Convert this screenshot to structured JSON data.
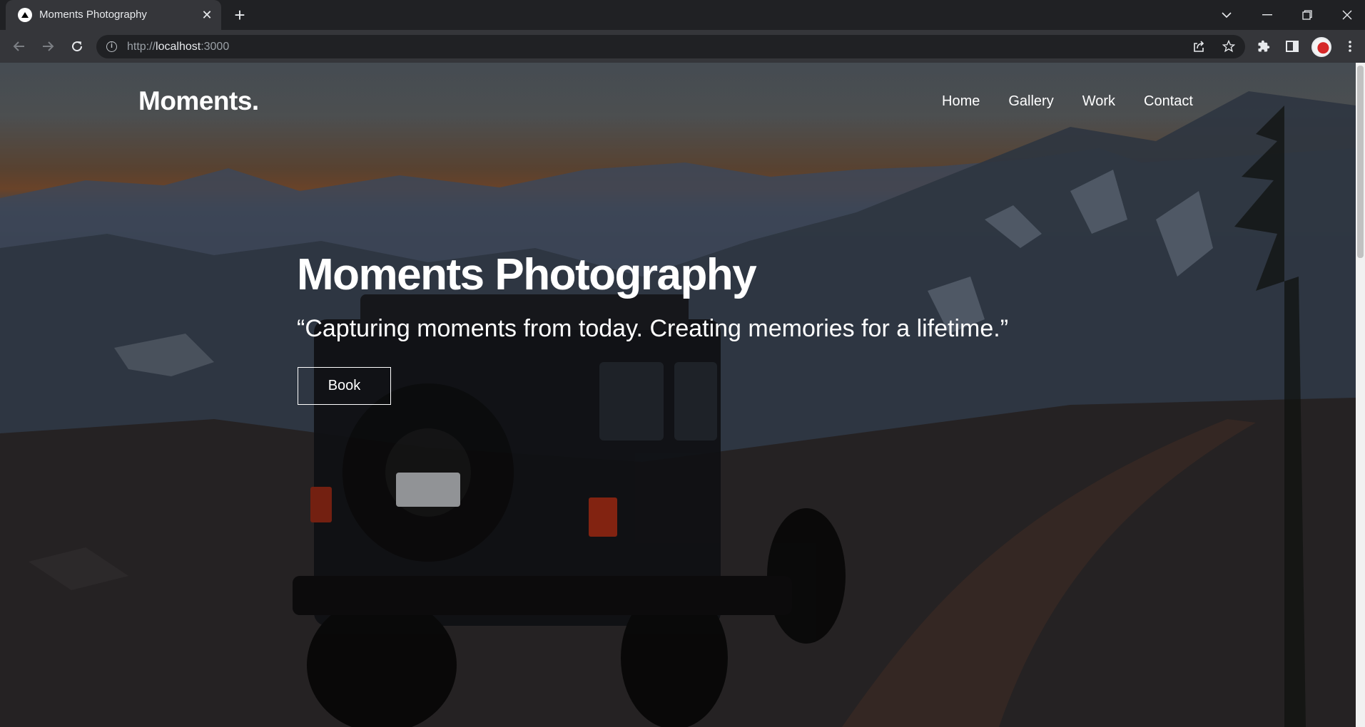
{
  "browser": {
    "tab_title": "Moments Photography",
    "url_scheme": "http://",
    "url_host": "localhost",
    "url_port": ":3000"
  },
  "site": {
    "logo": "Moments.",
    "nav": [
      "Home",
      "Gallery",
      "Work",
      "Contact"
    ],
    "hero_title": "Moments Photography",
    "hero_quote": "“Capturing moments from today. Creating memories for a lifetime.”",
    "book_label": "Book"
  }
}
